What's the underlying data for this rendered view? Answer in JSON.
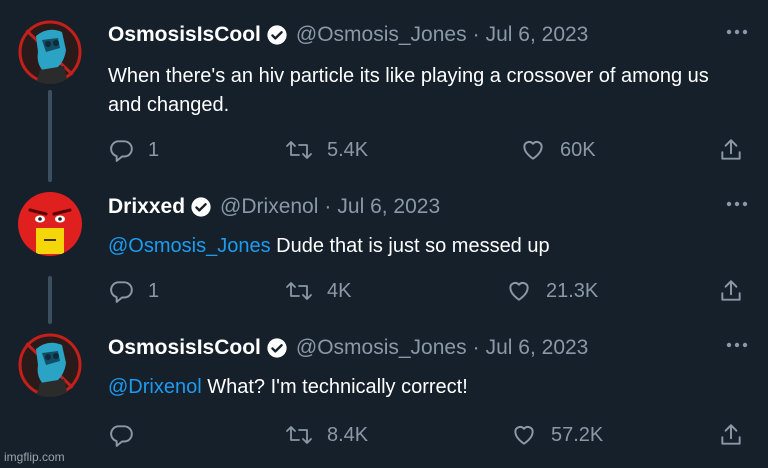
{
  "tweets": [
    {
      "display_name": "OsmosisIsCool",
      "handle": "@Osmosis_Jones",
      "separator": "·",
      "date": "Jul 6, 2023",
      "mention": "",
      "body": "When there's an hiv particle its like playing a crossover of among us and changed.",
      "replies": "1",
      "retweets": "5.4K",
      "likes": "60K"
    },
    {
      "display_name": "Drixxed",
      "handle": "@Drixenol",
      "separator": "·",
      "date": "Jul 6, 2023",
      "mention": "@Osmosis_Jones",
      "body": " Dude that is just so messed up",
      "replies": "1",
      "retweets": "4K",
      "likes": "21.3K"
    },
    {
      "display_name": "OsmosisIsCool",
      "handle": "@Osmosis_Jones",
      "separator": "·",
      "date": "Jul 6, 2023",
      "mention": "@Drixenol",
      "body": " What? I'm technically correct!",
      "replies": "",
      "retweets": "8.4K",
      "likes": "57.2K"
    }
  ],
  "icons": {
    "verified": "verified-badge-icon",
    "more": "more-options-icon",
    "reply": "reply-icon",
    "retweet": "retweet-icon",
    "like": "like-icon",
    "share": "share-icon"
  },
  "colors": {
    "background": "#15202b",
    "text": "#ffffff",
    "secondary": "#8b98a5",
    "link": "#1d9bf0",
    "thread_line": "#3d4f5f"
  },
  "watermark": "imgflip.com"
}
